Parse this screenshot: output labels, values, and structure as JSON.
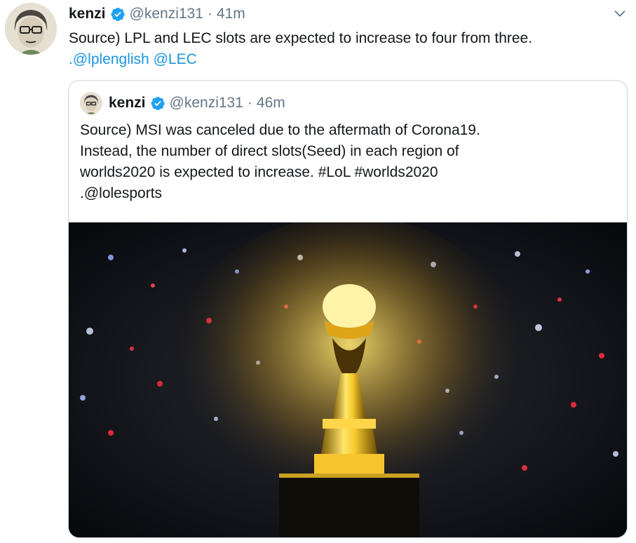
{
  "tweet": {
    "author_name": "kenzi",
    "handle": "@kenzi131",
    "separator": "·",
    "time": "41m",
    "text_main": "Source) LPL and LEC slots are expected to increase to four from three.",
    "text_prefix": ".",
    "mention_1": "@lplenglish",
    "mention_2": "@LEC"
  },
  "quoted_tweet": {
    "author_name": "kenzi",
    "handle": "@kenzi131",
    "separator": "·",
    "time": "46m",
    "line_1": "Source) MSI was canceled due to the aftermath of Corona19.",
    "line_2": "Instead, the number of direct slots(Seed) in each region of",
    "line_3": "worlds2020 is expected to increase.  #LoL  #worlds2020",
    "line_4": ".@lolesports"
  },
  "colors": {
    "link": "#1b95e0",
    "verified": "#1da1f2",
    "muted": "#657786",
    "border": "#ccd6dd"
  },
  "icons": {
    "verified": "verified-badge-icon",
    "menu": "chevron-down-icon"
  }
}
